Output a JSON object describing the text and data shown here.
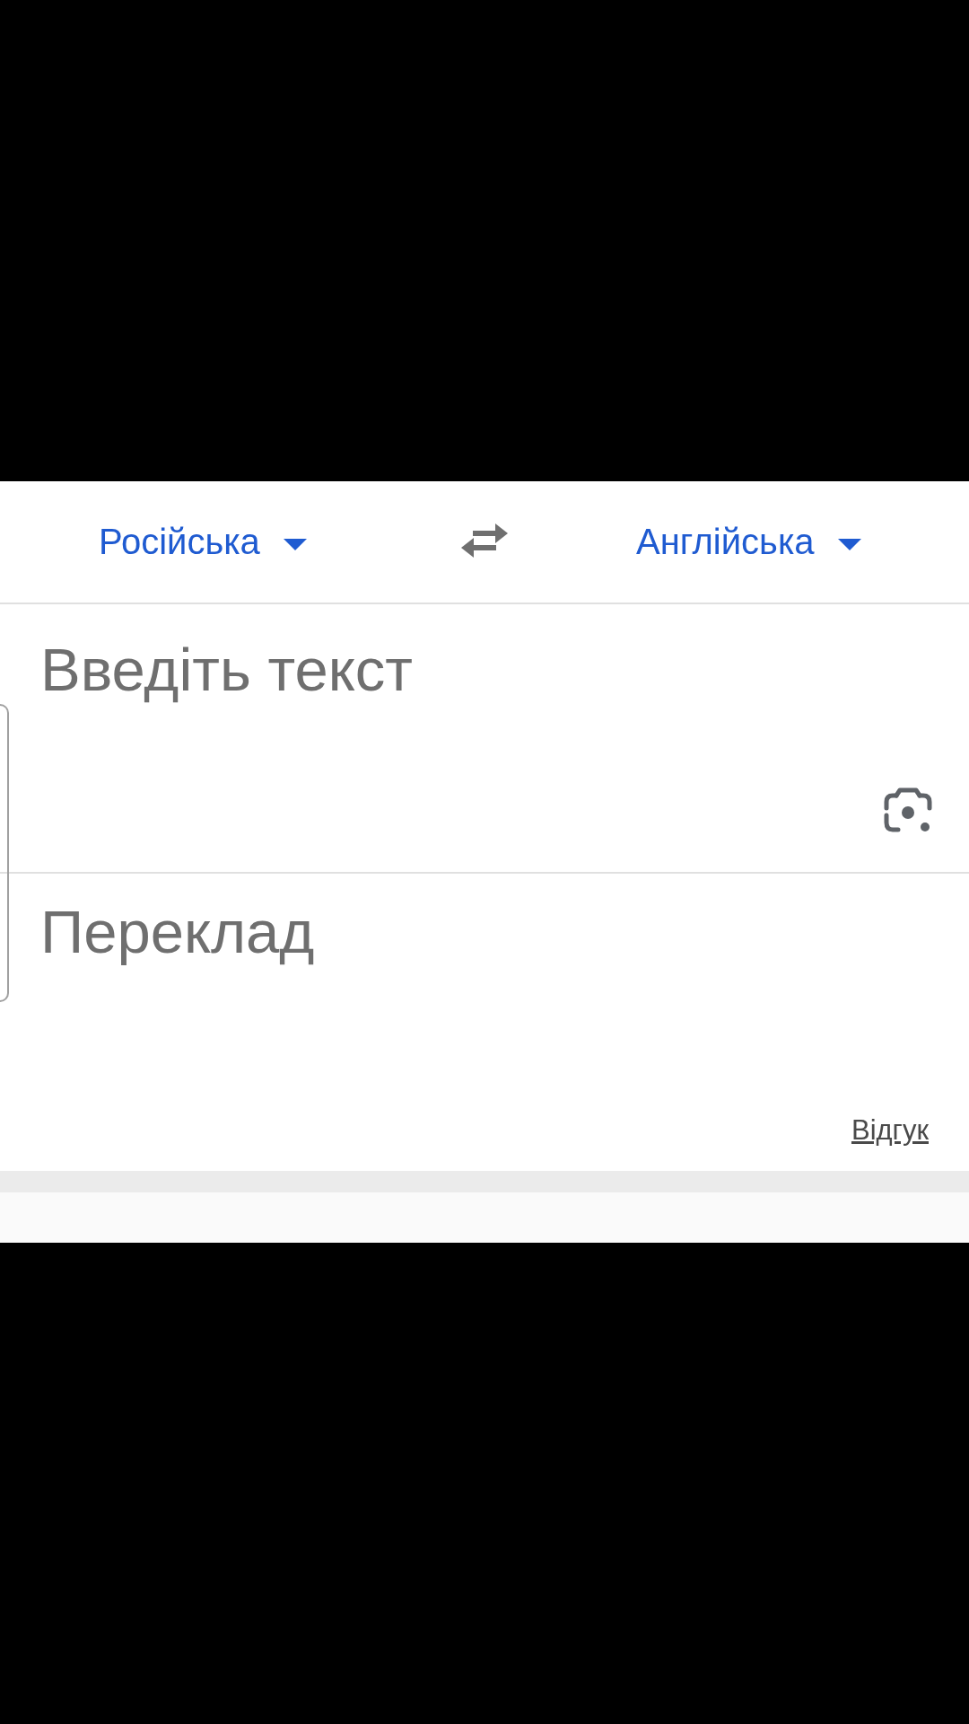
{
  "language_bar": {
    "source_language": {
      "label": "Російська"
    },
    "target_language": {
      "label": "Англійська"
    }
  },
  "input": {
    "placeholder": "Введіть текст"
  },
  "output": {
    "placeholder": "Переклад"
  },
  "feedback_link": {
    "label": "Відгук"
  }
}
